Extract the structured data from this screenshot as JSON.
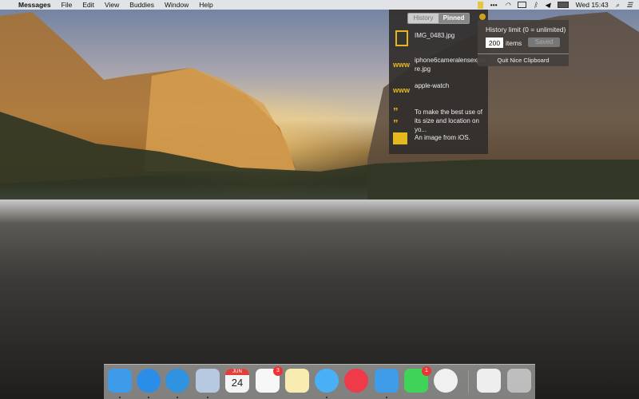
{
  "menubar": {
    "app": "Messages",
    "items": [
      "File",
      "Edit",
      "View",
      "Buddies",
      "Window",
      "Help"
    ],
    "clock": "Wed 15:43"
  },
  "clipboard": {
    "tabs": [
      "History",
      "Pinned"
    ],
    "items": [
      {
        "icon": "file-icon",
        "text": "IMG_0483.jpg"
      },
      {
        "icon": "www-icon",
        "text": "iphone6cameralensexplore.jpg"
      },
      {
        "icon": "www-icon",
        "text": "apple-watch"
      },
      {
        "icon": "quote-icon",
        "text": "To make the best use of its size and location on yo..."
      },
      {
        "icon": "image-icon",
        "text": "An image from iOS."
      }
    ],
    "www_label": "www",
    "settings": {
      "title": "History limit (0 = unlimited)",
      "limit": "200",
      "unit": "items",
      "saved": "Saved",
      "quit": "Quit Nice Clipboard"
    }
  },
  "dock": {
    "apps": [
      {
        "name": "finder",
        "color": "#3d9be9",
        "running": true
      },
      {
        "name": "app-store",
        "color": "#2a8ee8",
        "running": true
      },
      {
        "name": "safari",
        "color": "#2f93e0",
        "running": true
      },
      {
        "name": "mail",
        "color": "#b7c9e0",
        "running": true
      },
      {
        "name": "calendar",
        "color": "#f4f4f4",
        "label": "24",
        "month": "JUN"
      },
      {
        "name": "reminders",
        "color": "#f7f7f7",
        "badge": "3"
      },
      {
        "name": "notes",
        "color": "#f8ecb0"
      },
      {
        "name": "messages",
        "color": "#4ab0f5",
        "running": true
      },
      {
        "name": "itunes",
        "color": "#ef3a4a"
      },
      {
        "name": "tweetbot",
        "color": "#3e9ce8",
        "running": true
      },
      {
        "name": "facetime",
        "color": "#3fd35a",
        "badge": "1"
      },
      {
        "name": "photos",
        "color": "#f0f0f0"
      },
      {
        "name": "document",
        "color": "#eeeeee"
      },
      {
        "name": "trash",
        "color": "rgba(230,230,230,.6)"
      }
    ],
    "accent": "#e6b820"
  }
}
